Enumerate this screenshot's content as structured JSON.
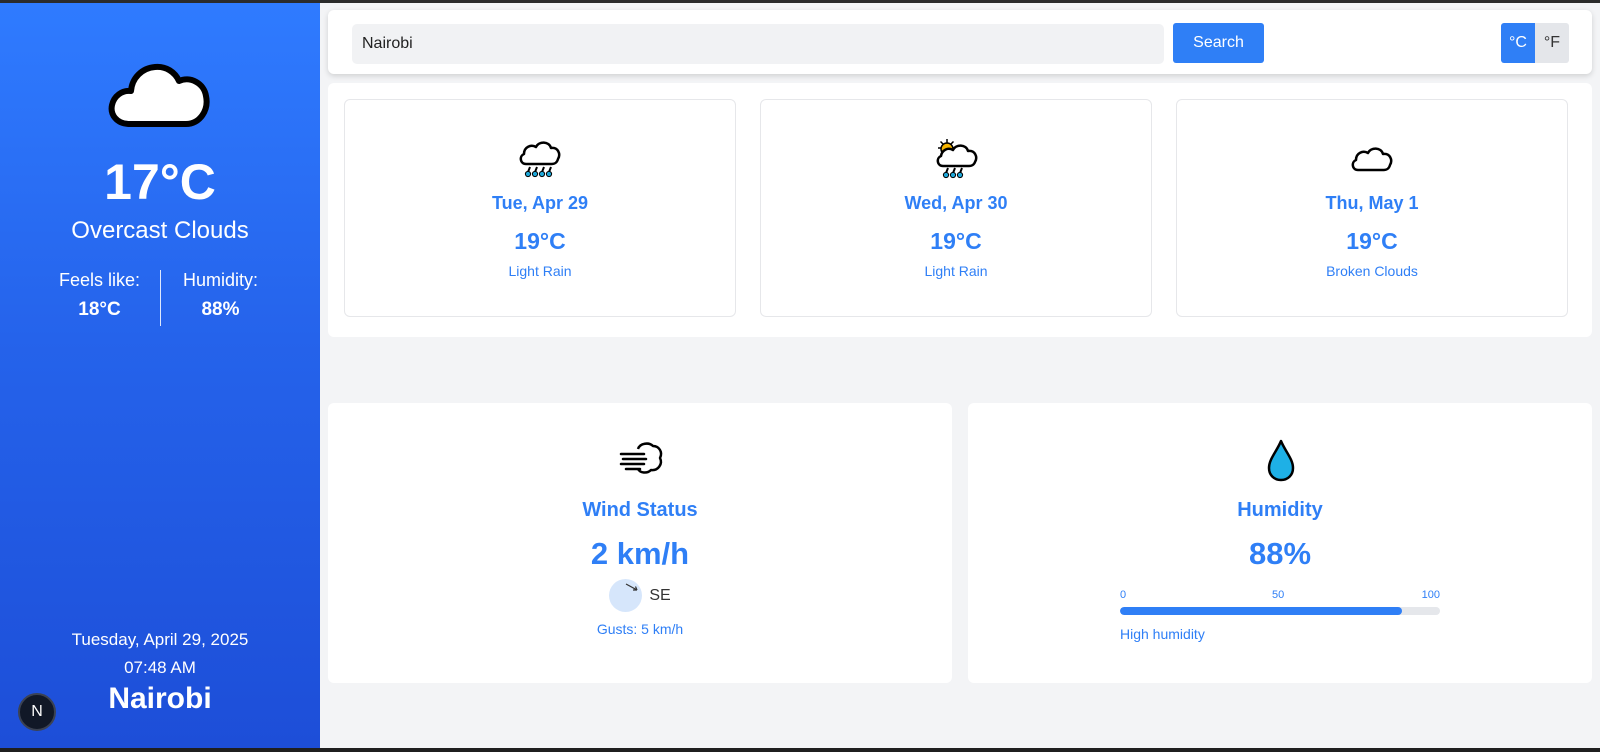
{
  "current": {
    "icon": "cloud-icon",
    "temperature": "17°C",
    "description": "Overcast Clouds",
    "feels_like_label": "Feels like:",
    "feels_like_value": "18°C",
    "humidity_label": "Humidity:",
    "humidity_value": "88%",
    "date": "Tuesday, April 29, 2025",
    "time": "07:48 AM",
    "city": "Nairobi"
  },
  "search": {
    "value": "Nairobi",
    "button_label": "Search"
  },
  "units": {
    "celsius_label": "°C",
    "fahrenheit_label": "°F",
    "active": "celsius"
  },
  "forecast": [
    {
      "date": "Tue, Apr 29",
      "temp": "19°C",
      "desc": "Light Rain",
      "icon": "rain-cloud-icon"
    },
    {
      "date": "Wed, Apr 30",
      "temp": "19°C",
      "desc": "Light Rain",
      "icon": "sun-rain-cloud-icon"
    },
    {
      "date": "Thu, May 1",
      "temp": "19°C",
      "desc": "Broken Clouds",
      "icon": "cloud-icon"
    }
  ],
  "wind": {
    "icon": "wind-icon",
    "title": "Wind Status",
    "speed": "2 km/h",
    "direction": "SE",
    "gusts": "Gusts: 5 km/h"
  },
  "humidity": {
    "icon": "water-drop-icon",
    "title": "Humidity",
    "value": "88%",
    "level": 88,
    "scale_min": "0",
    "scale_mid": "50",
    "scale_max": "100",
    "note": "High humidity"
  },
  "badge": {
    "letter": "N"
  },
  "colors": {
    "accent": "#2f7ff6",
    "sidebar_top": "#2f7bff",
    "sidebar_bottom": "#1d4ed8"
  }
}
